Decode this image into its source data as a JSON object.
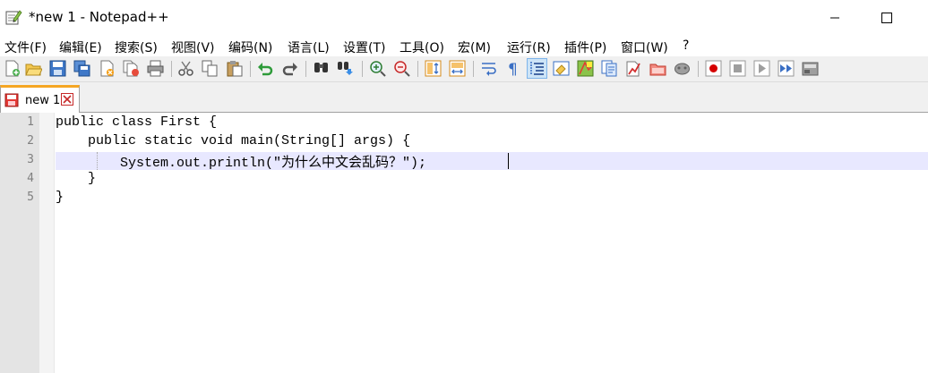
{
  "window": {
    "title": "*new 1 - Notepad++",
    "minimize_icon": "minimize-icon",
    "maximize_icon": "maximize-icon"
  },
  "menu": [
    {
      "label": "文件(F)"
    },
    {
      "label": "编辑(E)"
    },
    {
      "label": "搜索(S)"
    },
    {
      "label": "视图(V)"
    },
    {
      "label": "编码(N)"
    },
    {
      "label": "语言(L)"
    },
    {
      "label": "设置(T)"
    },
    {
      "label": "工具(O)"
    },
    {
      "label": "宏(M)"
    },
    {
      "label": "运行(R)"
    },
    {
      "label": "插件(P)"
    },
    {
      "label": "窗口(W)"
    },
    {
      "label": "?"
    }
  ],
  "toolbar": {
    "buttons": [
      "new-file",
      "open-file",
      "save",
      "save-all",
      "close",
      "close-all",
      "print",
      "cut",
      "copy",
      "paste",
      "undo",
      "redo",
      "find",
      "replace",
      "zoom-in",
      "zoom-out",
      "sync-vertical",
      "sync-horizontal",
      "word-wrap",
      "show-all-characters",
      "indent-guide",
      "user-defined-language",
      "document-map",
      "function-list",
      "folder-as-workspace",
      "monitoring",
      "start-record",
      "stop-record",
      "playback",
      "run-macro-multiple",
      "save-macro"
    ],
    "active": "indent-guide"
  },
  "tabs": [
    {
      "label": "new 1",
      "modified": true,
      "close_icon": "tab-close-icon"
    }
  ],
  "editor": {
    "line_numbers": [
      "1",
      "2",
      "3",
      "4",
      "5"
    ],
    "lines": [
      "public class First {",
      "    public static void main(String[] args) {",
      "        System.out.println(\"为什么中文会乱码？\");",
      "    }",
      "}"
    ],
    "current_line": 3,
    "colors": {
      "current_line": "#e8e8ff",
      "gutter": "#e4e4e4",
      "tab_accent": "#f5a623"
    }
  }
}
